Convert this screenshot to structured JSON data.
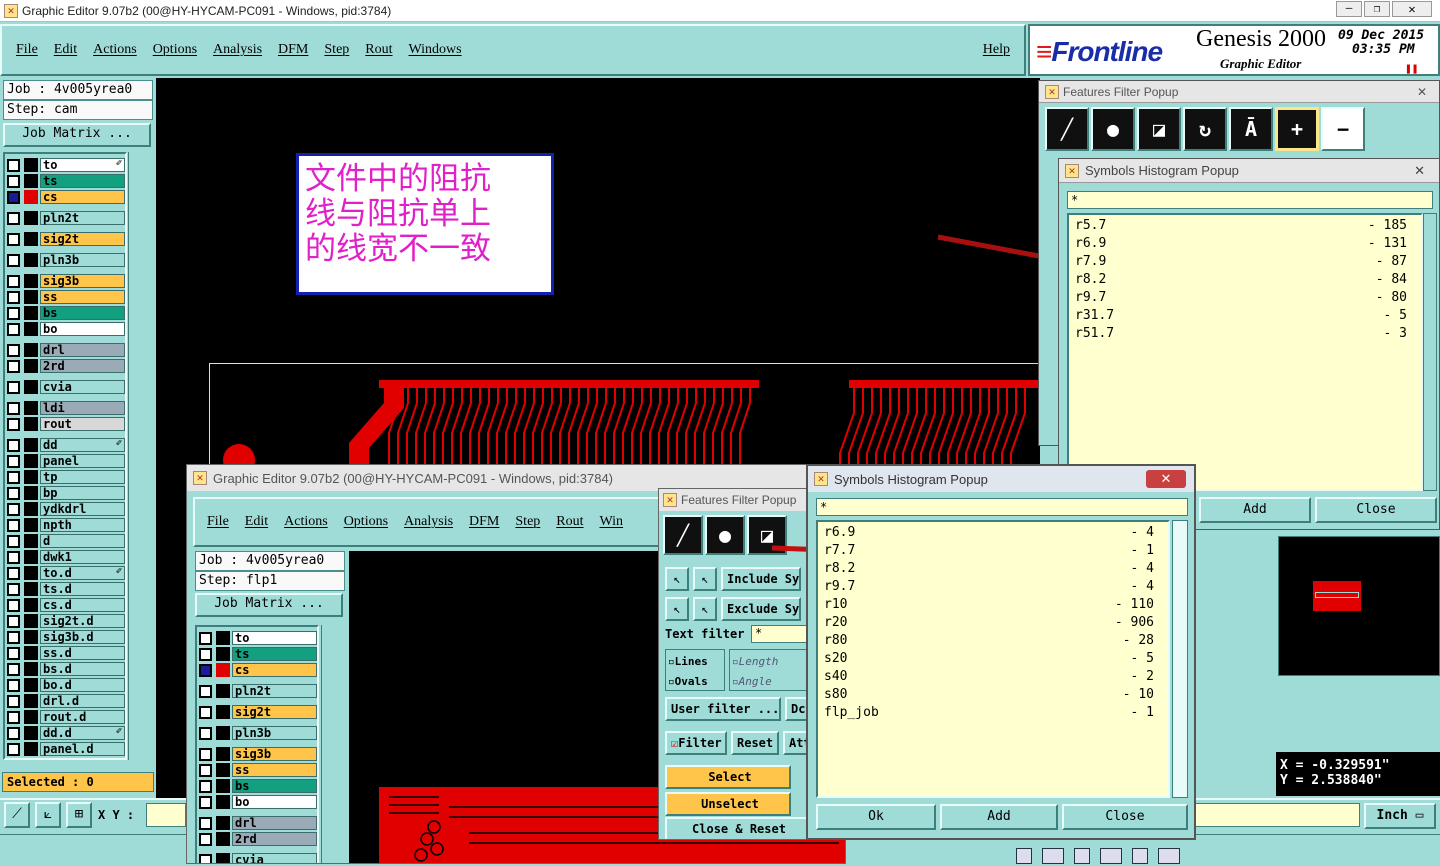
{
  "main_window": {
    "title": "Graphic Editor 9.07b2 (00@HY-HYCAM-PC091 - Windows, pid:3784)",
    "menu": [
      "File",
      "Edit",
      "Actions",
      "Options",
      "Analysis",
      "DFM",
      "Step",
      "Rout",
      "Windows"
    ],
    "help": "Help",
    "job": "Job : 4v005yrea0",
    "step": "Step: cam",
    "job_matrix": "Job Matrix ...",
    "selected": "Selected : 0",
    "xy_label": "X Y :",
    "unit": "Inch",
    "coord_x": "X = -0.329591\"",
    "coord_y": "Y = 2.538840\""
  },
  "brand": {
    "logo": "Frontline",
    "product": "Genesis 2000",
    "subtitle": "Graphic Editor",
    "date": "09 Dec 2015",
    "time": "03:35 PM"
  },
  "annotation": {
    "line1": "文件中的阻抗",
    "line2": "线与阻抗单上",
    "line3": "的线宽不一致"
  },
  "layers_main": [
    {
      "name": "to",
      "color": "#ffffff",
      "mark": true
    },
    {
      "name": "ts",
      "color": "#13a080"
    },
    {
      "name": "cs",
      "color": "#ffc44a",
      "active": true
    },
    {
      "gap": true
    },
    {
      "name": "pln2t",
      "color": "#9fdcd8"
    },
    {
      "gap": true
    },
    {
      "name": "sig2t",
      "color": "#ffc44a"
    },
    {
      "gap": true
    },
    {
      "name": "pln3b",
      "color": "#9fdcd8"
    },
    {
      "gap": true
    },
    {
      "name": "sig3b",
      "color": "#ffc44a"
    },
    {
      "name": "ss",
      "color": "#ffc44a"
    },
    {
      "name": "bs",
      "color": "#13a080"
    },
    {
      "name": "bo",
      "color": "#ffffff"
    },
    {
      "gap": true
    },
    {
      "name": "drl",
      "color": "#9aaab6"
    },
    {
      "name": "2rd",
      "color": "#9aaab6"
    },
    {
      "gap": true
    },
    {
      "name": "cvia",
      "color": "#9fdcd8"
    },
    {
      "gap": true
    },
    {
      "name": "ldi",
      "color": "#9aaab6"
    },
    {
      "name": "rout",
      "color": "#d8d8d8"
    },
    {
      "gap": true
    },
    {
      "name": "dd",
      "color": "#9fdcd8",
      "mark": true
    },
    {
      "name": "panel",
      "color": "#9fdcd8"
    },
    {
      "name": "tp",
      "color": "#9fdcd8"
    },
    {
      "name": "bp",
      "color": "#9fdcd8"
    },
    {
      "name": "ydkdrl",
      "color": "#9fdcd8"
    },
    {
      "name": "npth",
      "color": "#9fdcd8"
    },
    {
      "name": "d",
      "color": "#9fdcd8"
    },
    {
      "name": "dwk1",
      "color": "#9fdcd8"
    },
    {
      "name": "to.d",
      "color": "#9fdcd8",
      "mark": true
    },
    {
      "name": "ts.d",
      "color": "#9fdcd8"
    },
    {
      "name": "cs.d",
      "color": "#9fdcd8"
    },
    {
      "name": "sig2t.d",
      "color": "#9fdcd8"
    },
    {
      "name": "sig3b.d",
      "color": "#9fdcd8"
    },
    {
      "name": "ss.d",
      "color": "#9fdcd8"
    },
    {
      "name": "bs.d",
      "color": "#9fdcd8"
    },
    {
      "name": "bo.d",
      "color": "#9fdcd8"
    },
    {
      "name": "drl.d",
      "color": "#9fdcd8"
    },
    {
      "name": "rout.d",
      "color": "#9fdcd8"
    },
    {
      "name": "dd.d",
      "color": "#9fdcd8",
      "mark": true
    },
    {
      "name": "panel.d",
      "color": "#9fdcd8"
    }
  ],
  "features_filter_1": {
    "title": "Features Filter Popup"
  },
  "histogram_1": {
    "title": "Symbols Histogram Popup",
    "filter": "*",
    "rows": [
      [
        "r5.7",
        "- 185"
      ],
      [
        "r6.9",
        "- 131"
      ],
      [
        "r7.9",
        "- 87"
      ],
      [
        "r8.2",
        "- 84"
      ],
      [
        "r9.7",
        "- 80"
      ],
      [
        "r31.7",
        "- 5"
      ],
      [
        "r51.7",
        "- 3"
      ]
    ],
    "add": "Add",
    "close": "Close"
  },
  "second_window": {
    "title": "Graphic Editor 9.07b2 (00@HY-HYCAM-PC091 - Windows, pid:3784)",
    "menu": [
      "File",
      "Edit",
      "Actions",
      "Options",
      "Analysis",
      "DFM",
      "Step",
      "Rout",
      "Win"
    ],
    "job": "Job : 4v005yrea0",
    "step": "Step: flp1",
    "job_matrix": "Job Matrix ..."
  },
  "layers_second": [
    {
      "name": "to",
      "color": "#ffffff"
    },
    {
      "name": "ts",
      "color": "#13a080"
    },
    {
      "name": "cs",
      "color": "#ffc44a",
      "active": true
    },
    {
      "gap": true
    },
    {
      "name": "pln2t",
      "color": "#9fdcd8"
    },
    {
      "gap": true
    },
    {
      "name": "sig2t",
      "color": "#ffc44a"
    },
    {
      "gap": true
    },
    {
      "name": "pln3b",
      "color": "#9fdcd8"
    },
    {
      "gap": true
    },
    {
      "name": "sig3b",
      "color": "#ffc44a"
    },
    {
      "name": "ss",
      "color": "#ffc44a"
    },
    {
      "name": "bs",
      "color": "#13a080"
    },
    {
      "name": "bo",
      "color": "#ffffff"
    },
    {
      "gap": true
    },
    {
      "name": "drl",
      "color": "#9aaab6"
    },
    {
      "name": "2rd",
      "color": "#9aaab6"
    },
    {
      "gap": true
    },
    {
      "name": "cvia",
      "color": "#9fdcd8"
    }
  ],
  "features_filter_2": {
    "title": "Features Filter Popup",
    "include": "Include Sym",
    "exclude": "Exclude Sym",
    "text_filter": "Text filter",
    "text_value": "*",
    "lines": "Lines",
    "ovals": "Ovals",
    "length": "Length",
    "angle": "Angle",
    "user_filter": "User filter ...",
    "dc": "Dc",
    "filter": "Filter",
    "reset": "Reset",
    "att": "Att",
    "select": "Select",
    "unselect": "Unselect",
    "close_reset": "Close & Reset"
  },
  "histogram_2": {
    "title": "Symbols Histogram Popup",
    "filter": "*",
    "rows": [
      [
        "r6.9",
        "- 4"
      ],
      [
        "r7.7",
        "- 1"
      ],
      [
        "r8.2",
        "- 4"
      ],
      [
        "r9.7",
        "- 4"
      ],
      [
        "r10",
        "- 110"
      ],
      [
        "r20",
        "- 906"
      ],
      [
        "r80",
        "- 28"
      ],
      [
        "s20",
        "- 5"
      ],
      [
        "s40",
        "- 2"
      ],
      [
        "s80",
        "- 10"
      ],
      [
        "flp_job",
        "- 1"
      ]
    ],
    "ok": "Ok",
    "add": "Add",
    "close": "Close"
  }
}
